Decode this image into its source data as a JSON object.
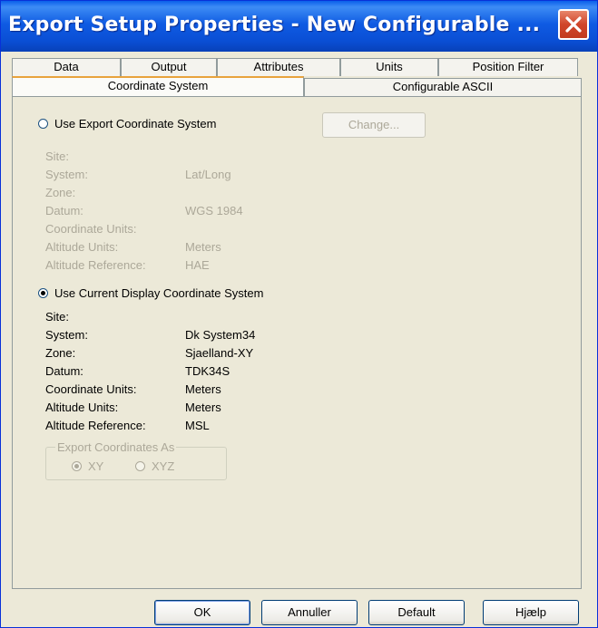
{
  "window": {
    "title": "Export Setup Properties - New Configurable ...",
    "close_icon": "close-icon"
  },
  "tabs": {
    "row1": [
      "Data",
      "Output",
      "Attributes",
      "Units",
      "Position Filter"
    ],
    "row2": [
      "Coordinate System",
      "Configurable ASCII"
    ],
    "active": "Coordinate System"
  },
  "export_cs": {
    "radio_label": "Use Export Coordinate System",
    "selected": false,
    "change_button": "Change...",
    "fields": [
      {
        "label": "Site:",
        "value": ""
      },
      {
        "label": "System:",
        "value": "Lat/Long"
      },
      {
        "label": "Zone:",
        "value": ""
      },
      {
        "label": "Datum:",
        "value": "WGS 1984"
      },
      {
        "label": "Coordinate Units:",
        "value": ""
      },
      {
        "label": "Altitude Units:",
        "value": "Meters"
      },
      {
        "label": "Altitude Reference:",
        "value": "HAE"
      }
    ]
  },
  "current_cs": {
    "radio_label": "Use Current Display Coordinate System",
    "selected": true,
    "fields": [
      {
        "label": "Site:",
        "value": ""
      },
      {
        "label": "System:",
        "value": "Dk System34"
      },
      {
        "label": "Zone:",
        "value": "Sjaelland-XY"
      },
      {
        "label": "Datum:",
        "value": "TDK34S"
      },
      {
        "label": "Coordinate Units:",
        "value": "Meters"
      },
      {
        "label": "Altitude Units:",
        "value": "Meters"
      },
      {
        "label": "Altitude Reference:",
        "value": "MSL"
      }
    ]
  },
  "export_coords": {
    "group_label": "Export Coordinates As",
    "options": [
      "XY",
      "XYZ"
    ],
    "selected": "XY",
    "enabled": false
  },
  "buttons": {
    "ok": "OK",
    "cancel": "Annuller",
    "default": "Default",
    "help": "Hjælp"
  }
}
